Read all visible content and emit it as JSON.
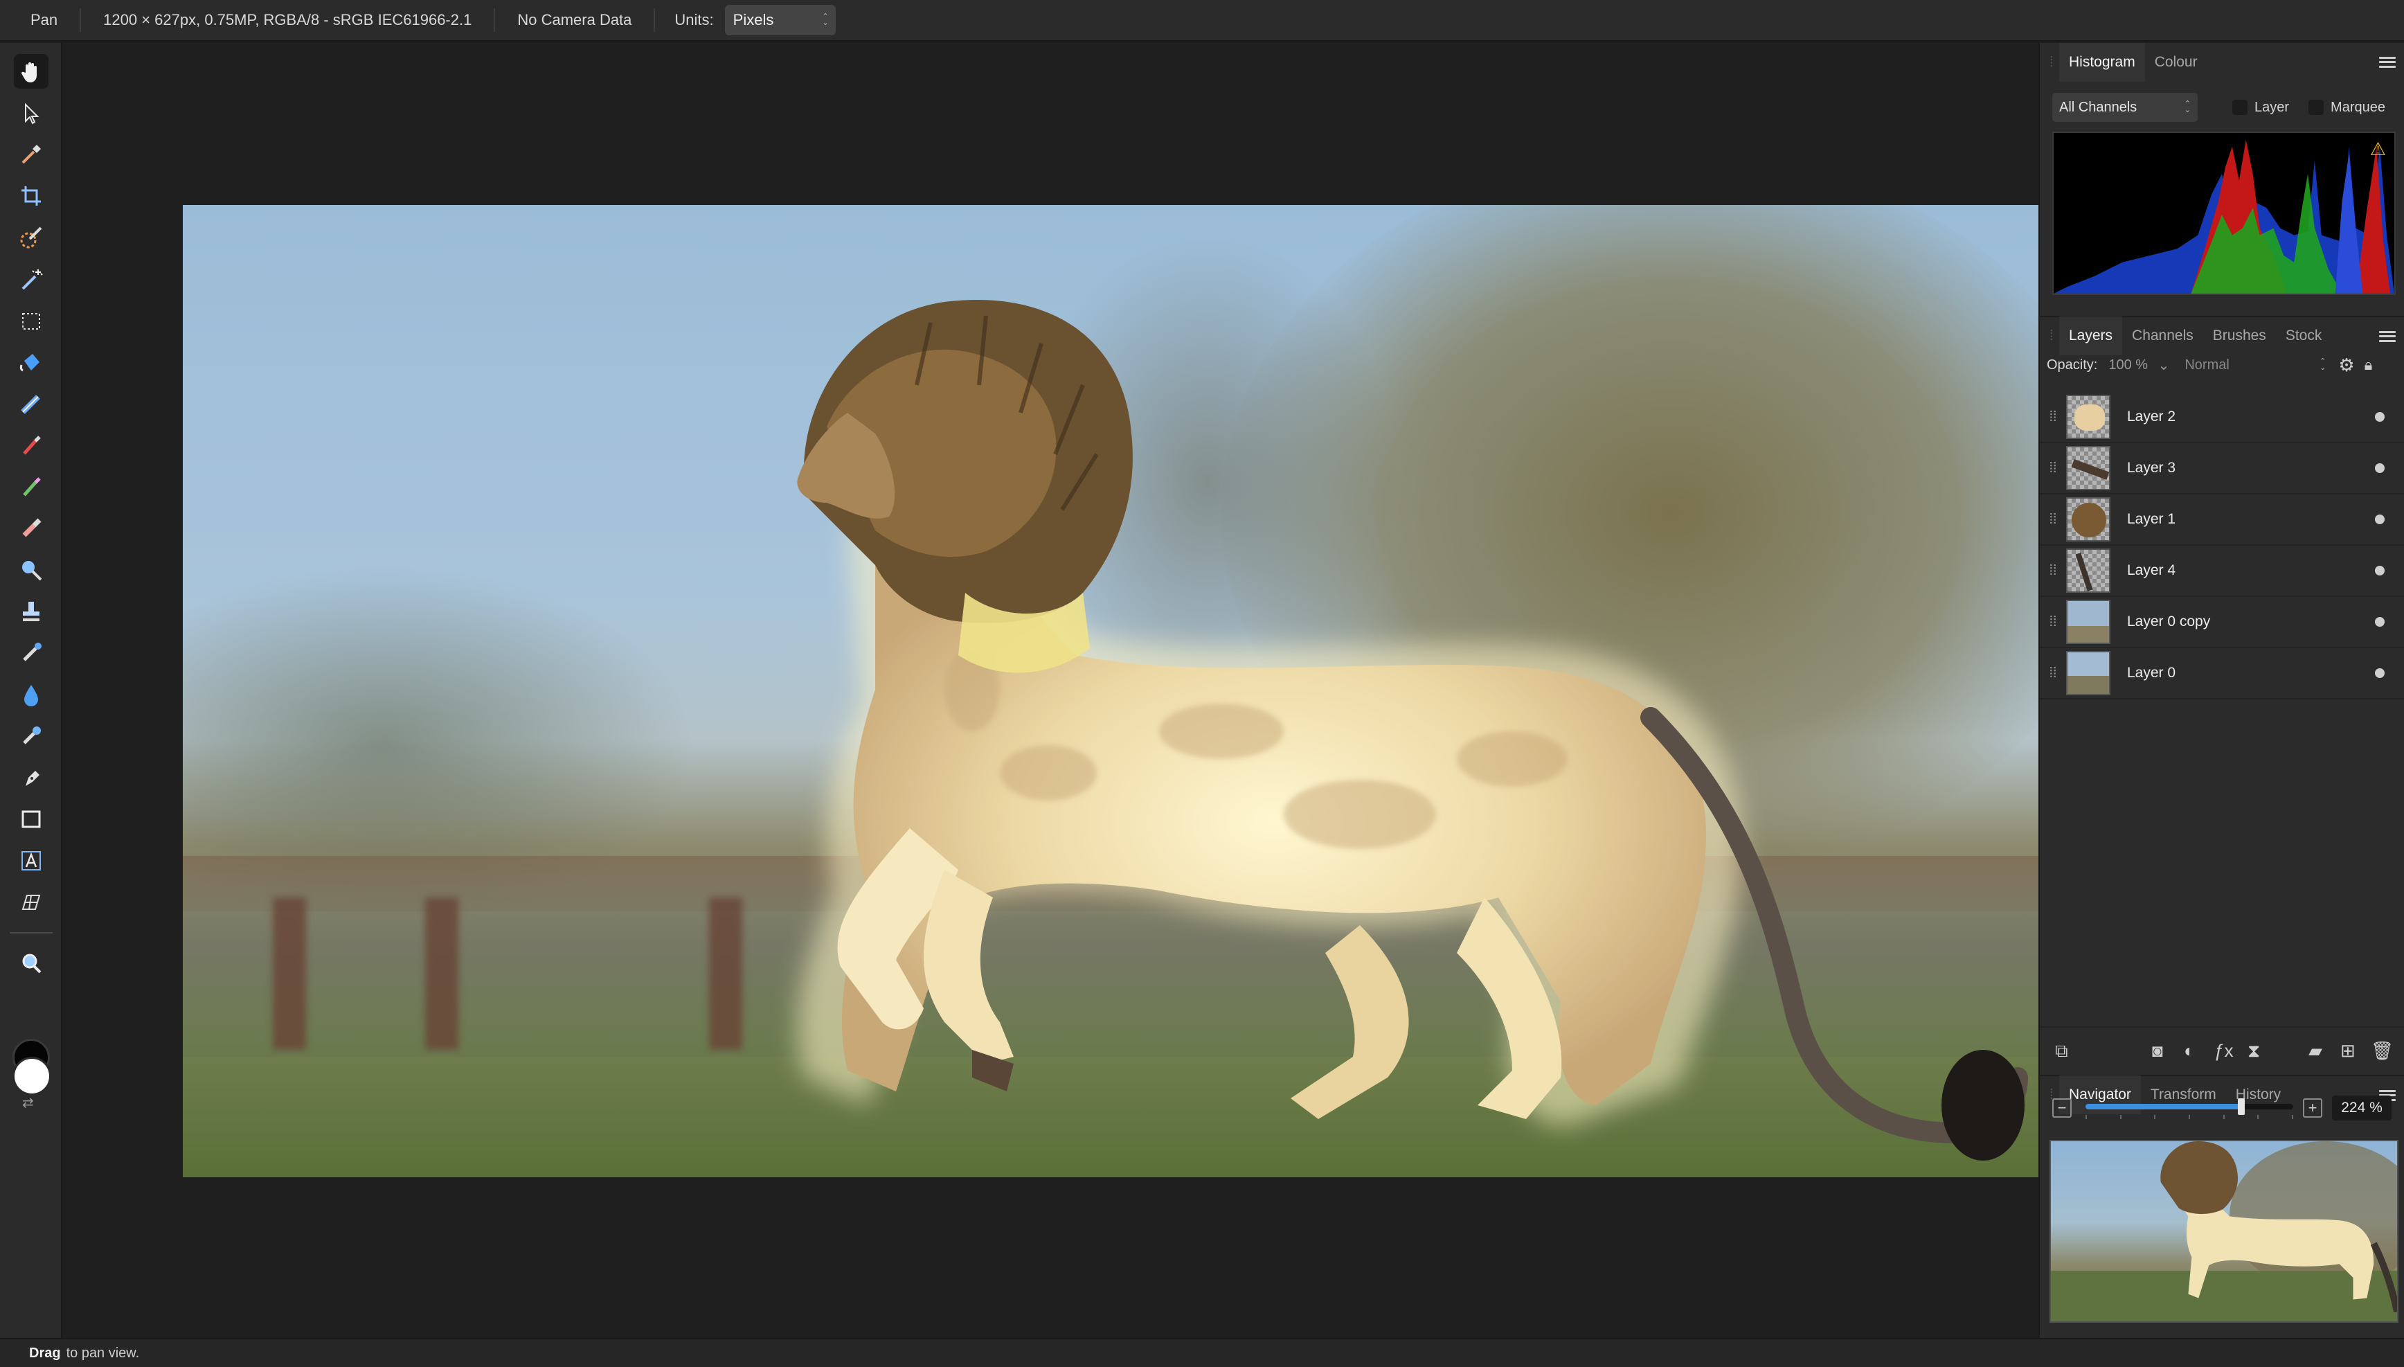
{
  "context_toolbar": {
    "tool_name": "Pan",
    "doc_info": "1200 × 627px, 0.75MP, RGBA/8 - sRGB IEC61966-2.1",
    "camera_info": "No Camera Data",
    "units_label": "Units:",
    "units_value": "Pixels"
  },
  "tools": [
    {
      "name": "hand-icon",
      "active": true
    },
    {
      "name": "move-icon"
    },
    {
      "name": "color-picker-icon"
    },
    {
      "name": "crop-icon"
    },
    {
      "name": "selection-brush-icon"
    },
    {
      "name": "flood-select-icon"
    },
    {
      "name": "marquee-icon"
    },
    {
      "name": "flood-fill-icon"
    },
    {
      "name": "gradient-icon"
    },
    {
      "name": "paint-brush-icon"
    },
    {
      "name": "color-replacement-icon"
    },
    {
      "name": "erase-brush-icon"
    },
    {
      "name": "dodge-icon"
    },
    {
      "name": "clone-stamp-icon"
    },
    {
      "name": "healing-brush-icon"
    },
    {
      "name": "blur-brush-icon"
    },
    {
      "name": "smudge-icon"
    },
    {
      "name": "pen-icon"
    },
    {
      "name": "rectangle-icon"
    },
    {
      "name": "text-icon"
    },
    {
      "name": "mesh-warp-icon"
    },
    {
      "name": "zoom-icon"
    }
  ],
  "colors": {
    "primary_swatch": "#ffffff",
    "secondary_swatch": "#050505",
    "accent": "#3f8fe0"
  },
  "histogram_panel": {
    "tabs": [
      "Histogram",
      "Colour"
    ],
    "active_tab": "Histogram",
    "channels_value": "All Channels",
    "layer_check_label": "Layer",
    "marquee_check_label": "Marquee",
    "warning_icon": "warning-icon"
  },
  "layers_panel": {
    "tabs": [
      "Layers",
      "Channels",
      "Brushes",
      "Stock"
    ],
    "active_tab": "Layers",
    "opacity_label": "Opacity:",
    "opacity_value": "100 %",
    "blend_mode": "Normal",
    "layers": [
      {
        "name": "Layer 2",
        "visible": true
      },
      {
        "name": "Layer 3",
        "visible": true
      },
      {
        "name": "Layer 1",
        "visible": true
      },
      {
        "name": "Layer 4",
        "visible": true
      },
      {
        "name": "Layer 0 copy",
        "visible": true
      },
      {
        "name": "Layer 0",
        "visible": true
      }
    ]
  },
  "navigator_panel": {
    "tabs": [
      "Navigator",
      "Transform",
      "History"
    ],
    "active_tab": "Navigator",
    "zoom_value": "224 %",
    "zoom_fraction": 0.75
  },
  "status": {
    "bold": "Drag",
    "text": "to pan view."
  }
}
